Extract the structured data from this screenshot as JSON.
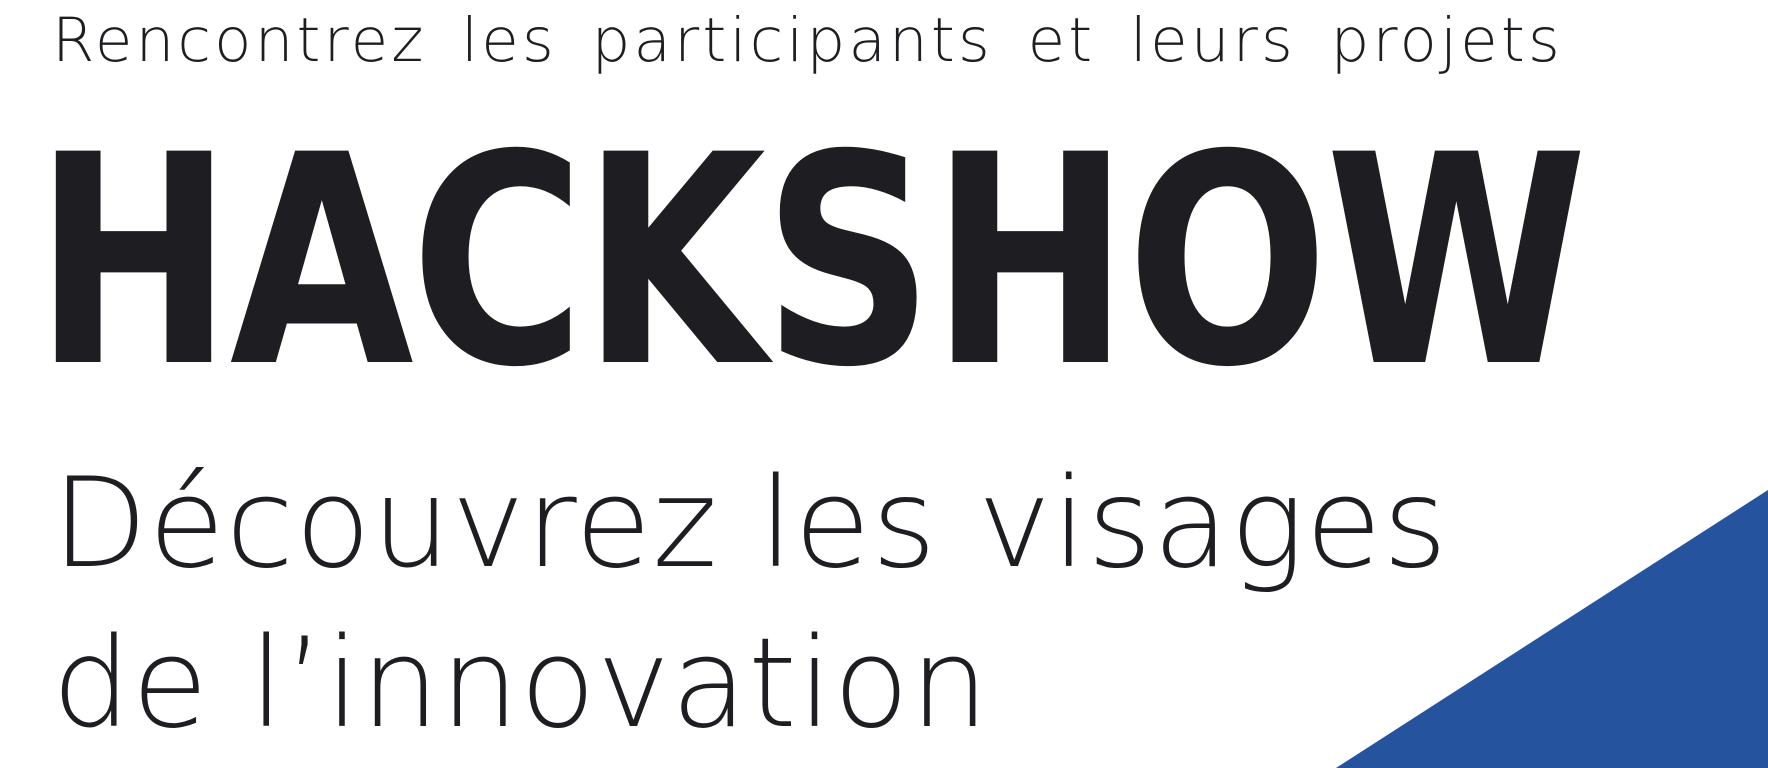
{
  "header": {
    "subtitle": "Rencontrez les participants et leurs projets"
  },
  "title": "HACKSHOW",
  "tagline": {
    "line1": "Découvrez les visages",
    "line2": "de l’innovation"
  },
  "colors": {
    "text": "#1e1e22",
    "accent": "#26539d",
    "background": "#ffffff"
  }
}
